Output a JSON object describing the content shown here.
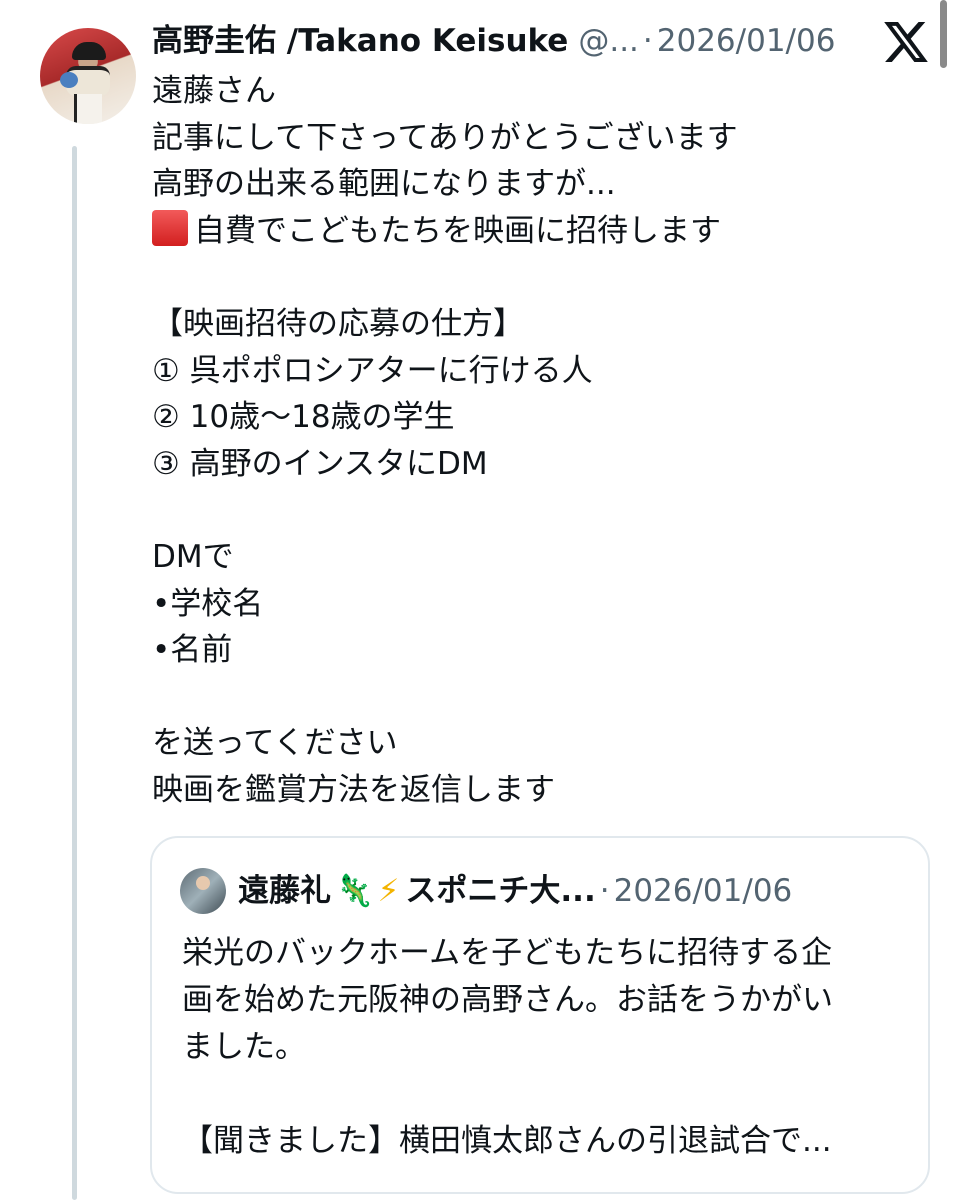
{
  "author": {
    "name": "高野圭佑 /Takano Keisuke",
    "handle": "@...",
    "separator": "·",
    "date": "2026/01/06"
  },
  "icons": {
    "platform": "x-logo-icon",
    "emphasis": "red-square-icon"
  },
  "post": {
    "lines": [
      "遠藤さん",
      "記事にして下さってありがとうございます",
      "高野の出来る範囲になりますが...",
      "自費でこどもたちを映画に招待します",
      "",
      "【映画招待の応募の仕方】",
      "① 呉ポポロシアターに行ける人",
      "② 10歳〜18歳の学生",
      "③ 高野のインスタにDM",
      "",
      "DMで",
      "•学校名",
      "•名前",
      "",
      "を送ってください",
      "映画を鑑賞方法を返信します"
    ]
  },
  "quote": {
    "author_name": "遠藤礼",
    "emoji_1": "🦎",
    "emoji_2": "⚡",
    "author_name_rest": "スポニチ大...",
    "separator": "·",
    "date": "2026/01/06",
    "lines": [
      "栄光のバックホームを子どもたちに招待する企",
      "画を始めた元阪神の高野さん。お話をうかがい",
      "ました。",
      "",
      "【聞きました】横田慎太郎さんの引退試合で..."
    ]
  },
  "colors": {
    "text": "#0f1419",
    "secondary": "#536471",
    "border": "#e1e8ed",
    "thread_line": "#cfd9de"
  }
}
